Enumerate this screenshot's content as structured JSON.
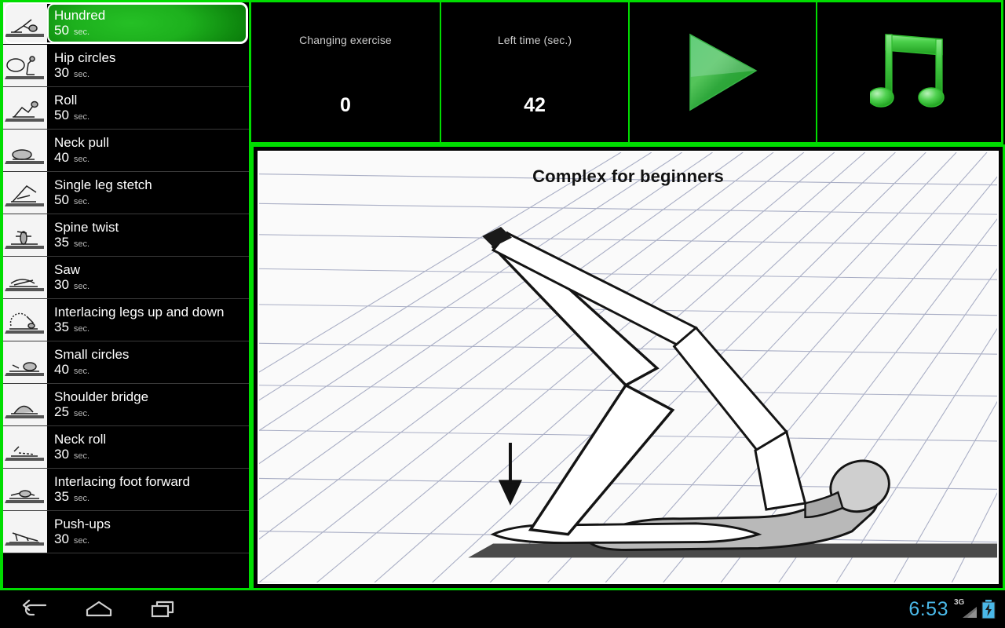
{
  "app": {
    "program_title": "Complex for beginners"
  },
  "sidebar": {
    "unit_label": "sec.",
    "exercises": [
      {
        "name": "Hundred",
        "duration": "50",
        "unit": "sec.",
        "selected": true,
        "pose": "hundred"
      },
      {
        "name": "Hip circles",
        "duration": "30",
        "unit": "sec.",
        "selected": false,
        "pose": "hip-circles"
      },
      {
        "name": "Roll",
        "duration": "50",
        "unit": "sec.",
        "selected": false,
        "pose": "roll"
      },
      {
        "name": "Neck pull",
        "duration": "40",
        "unit": "sec.",
        "selected": false,
        "pose": "neck-pull"
      },
      {
        "name": "Single leg stetch",
        "duration": "50",
        "unit": "sec.",
        "selected": false,
        "pose": "single-leg-stretch"
      },
      {
        "name": "Spine twist",
        "duration": "35",
        "unit": "sec.",
        "selected": false,
        "pose": "spine-twist"
      },
      {
        "name": "Saw",
        "duration": "30",
        "unit": "sec.",
        "selected": false,
        "pose": "saw"
      },
      {
        "name": "Interlacing legs up and down",
        "duration": "35",
        "unit": "sec.",
        "selected": false,
        "pose": "interlacing-legs"
      },
      {
        "name": "Small circles",
        "duration": "40",
        "unit": "sec.",
        "selected": false,
        "pose": "small-circles"
      },
      {
        "name": "Shoulder bridge",
        "duration": "25",
        "unit": "sec.",
        "selected": false,
        "pose": "shoulder-bridge"
      },
      {
        "name": "Neck roll",
        "duration": "30",
        "unit": "sec.",
        "selected": false,
        "pose": "neck-roll"
      },
      {
        "name": "Interlacing foot forward",
        "duration": "35",
        "unit": "sec.",
        "selected": false,
        "pose": "interlacing-foot"
      },
      {
        "name": "Push-ups",
        "duration": "30",
        "unit": "sec.",
        "selected": false,
        "pose": "push-ups"
      }
    ]
  },
  "top_bar": {
    "changing_exercise": {
      "label": "Changing exercise",
      "value": "0"
    },
    "left_time": {
      "label": "Left time (sec.)",
      "value": "42"
    },
    "play_button": {
      "icon": "play-icon"
    },
    "music_button": {
      "icon": "music-note-icon"
    }
  },
  "status_bar": {
    "clock": "6:53",
    "network": "3G",
    "battery_icon": "battery-charging-icon",
    "nav": {
      "back": "back-icon",
      "home": "home-icon",
      "recents": "recent-apps-icon"
    }
  },
  "colors": {
    "accent_green": "#00dd00",
    "selected_green": "#1db01d",
    "clock_blue": "#4ab8e8",
    "panel_black": "#000000",
    "canvas_white": "#fafafa"
  }
}
